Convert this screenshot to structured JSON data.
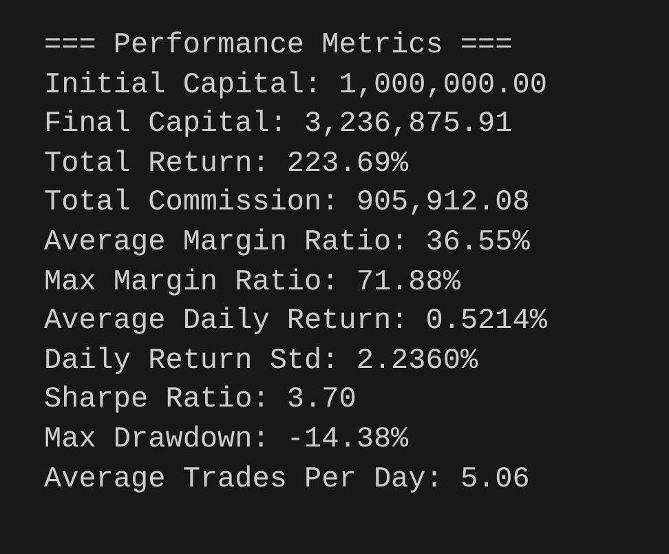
{
  "lines": [
    "=== Performance Metrics ===",
    "Initial Capital: 1,000,000.00",
    "Final Capital: 3,236,875.91",
    "Total Return: 223.69%",
    "Total Commission: 905,912.08",
    "Average Margin Ratio: 36.55%",
    "Max Margin Ratio: 71.88%",
    "Average Daily Return: 0.5214%",
    "Daily Return Std: 2.2360%",
    "Sharpe Ratio: 3.70",
    "Max Drawdown: -14.38%",
    "Average Trades Per Day: 5.06"
  ]
}
